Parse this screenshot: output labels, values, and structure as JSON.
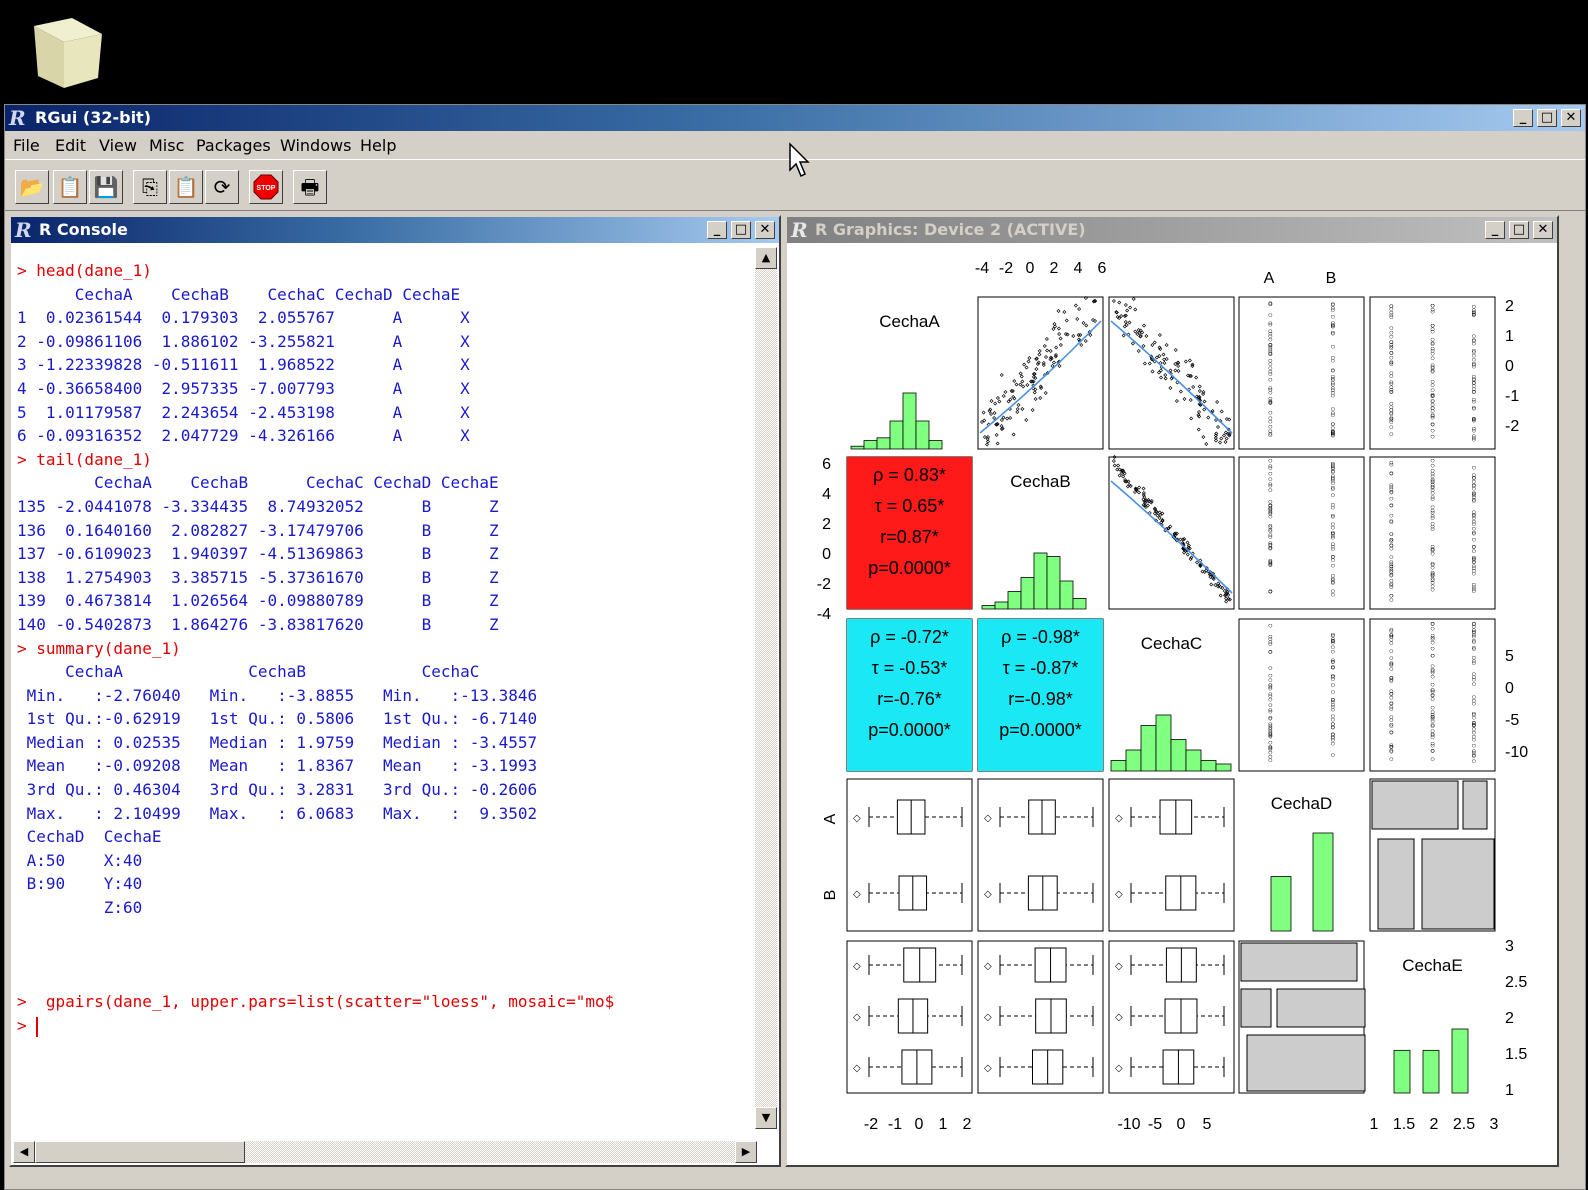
{
  "app": {
    "title": "RGui (32-bit)"
  },
  "menu": [
    "File",
    "Edit",
    "View",
    "Misc",
    "Packages",
    "Windows",
    "Help"
  ],
  "toolbar_icons": [
    "open-script-icon",
    "load-workspace-icon",
    "save-icon",
    "copy-icon",
    "paste-icon",
    "refresh-icon",
    "stop-icon",
    "print-icon"
  ],
  "console": {
    "title": "R Console",
    "lines": [
      {
        "t": "> head(dane_1)",
        "cmd": true
      },
      {
        "t": "      CechaA    CechaB    CechaC CechaD CechaE"
      },
      {
        "t": "1  0.02361544  0.179303  2.055767      A      X"
      },
      {
        "t": "2 -0.09861106  1.886102 -3.255821      A      X"
      },
      {
        "t": "3 -1.22339828 -0.511611  1.968522      A      X"
      },
      {
        "t": "4 -0.36658400  2.957335 -7.007793      A      X"
      },
      {
        "t": "5  1.01179587  2.243654 -2.453198      A      X"
      },
      {
        "t": "6 -0.09316352  2.047729 -4.326166      A      X"
      },
      {
        "t": "> tail(dane_1)",
        "cmd": true
      },
      {
        "t": "        CechaA    CechaB      CechaC CechaD CechaE"
      },
      {
        "t": "135 -2.0441078 -3.334435  8.74932052      B      Z"
      },
      {
        "t": "136  0.1640160  2.082827 -3.17479706      B      Z"
      },
      {
        "t": "137 -0.6109023  1.940397 -4.51369863      B      Z"
      },
      {
        "t": "138  1.2754903  3.385715 -5.37361670      B      Z"
      },
      {
        "t": "139  0.4673814  1.026564 -0.09880789      B      Z"
      },
      {
        "t": "140 -0.5402873  1.864276 -3.83817620      B      Z"
      },
      {
        "t": "> summary(dane_1)",
        "cmd": true
      },
      {
        "t": "     CechaA             CechaB            CechaC"
      },
      {
        "t": " Min.   :-2.76040   Min.   :-3.8855   Min.   :-13.3846"
      },
      {
        "t": " 1st Qu.:-0.62919   1st Qu.: 0.5806   1st Qu.: -6.7140"
      },
      {
        "t": " Median : 0.02535   Median : 1.9759   Median : -3.4557"
      },
      {
        "t": " Mean   :-0.09208   Mean   : 1.8367   Mean   : -3.1993"
      },
      {
        "t": " 3rd Qu.: 0.46304   3rd Qu.: 3.2831   3rd Qu.: -0.2606"
      },
      {
        "t": " Max.   : 2.10499   Max.   : 6.0683   Max.   :  9.3502"
      },
      {
        "t": " CechaD  CechaE"
      },
      {
        "t": " A:50    X:40"
      },
      {
        "t": " B:90    Y:40"
      },
      {
        "t": "         Z:60"
      },
      {
        "t": ""
      },
      {
        "t": ""
      },
      {
        "t": ""
      },
      {
        "t": ">  gpairs(dane_1, upper.pars=list(scatter=\"loess\", mosaic=\"mo$",
        "cmd": true
      },
      {
        "t": "> ",
        "cmd": true
      }
    ]
  },
  "graphics": {
    "title": "R Graphics: Device 2 (ACTIVE)",
    "variables": [
      "CechaA",
      "CechaB",
      "CechaC",
      "CechaD",
      "CechaE"
    ],
    "top_axis_labels": [
      "-4",
      "-2",
      "0",
      "2",
      "4",
      "6"
    ],
    "top_cat_labels": [
      "A",
      "B"
    ],
    "right_axis_1": [
      "2",
      "1",
      "0",
      "-1",
      "-2"
    ],
    "right_axis_3": [
      "5",
      "0",
      "-5",
      "-10"
    ],
    "right_axis_5": [
      "3",
      "2.5",
      "2",
      "1.5",
      "1"
    ],
    "left_axis_2": [
      "6",
      "4",
      "2",
      "0",
      "-2",
      "-4"
    ],
    "left_cat_labels": [
      "A",
      "B"
    ],
    "bottom_axis_1": [
      "-2",
      "-1",
      "0",
      "1",
      "2"
    ],
    "bottom_axis_3": [
      "-10",
      "-5",
      "0",
      "5"
    ],
    "bottom_axis_5": [
      "1",
      "1.5",
      "2",
      "2.5",
      "3"
    ],
    "corr_AB": [
      "ρ = 0.83*",
      "τ = 0.65*",
      "r=0.87*",
      "p=0.0000*"
    ],
    "corr_AC": [
      "ρ = -0.72*",
      "τ = -0.53*",
      "r=-0.76*",
      "p=0.0000*"
    ],
    "corr_BC": [
      "ρ = -0.98*",
      "τ = -0.87*",
      "r=-0.98*",
      "p=0.0000*"
    ],
    "colors": {
      "positive": "#ff1a1a",
      "negative": "#1ae8f5",
      "hist": "#80ff80",
      "loess": "#4a90e2",
      "mosaic": "#cccccc"
    }
  },
  "chart_data": {
    "type": "scatter",
    "title": "",
    "panels": "5x5 generalized pairs plot (gpairs)",
    "histograms": {
      "CechaA": [
        1,
        3,
        4,
        10,
        20,
        10,
        3
      ],
      "CechaB": [
        1,
        2,
        5,
        9,
        16,
        15,
        8,
        3
      ],
      "CechaC": [
        3,
        6,
        13,
        16,
        9,
        6,
        3,
        2
      ],
      "CechaD": [
        {
          "category": "A",
          "count": 50
        },
        {
          "category": "B",
          "count": 90
        }
      ],
      "CechaE": [
        {
          "category": "X",
          "count": 40
        },
        {
          "category": "Y",
          "count": 40
        },
        {
          "category": "Z",
          "count": 60
        }
      ]
    }
  }
}
